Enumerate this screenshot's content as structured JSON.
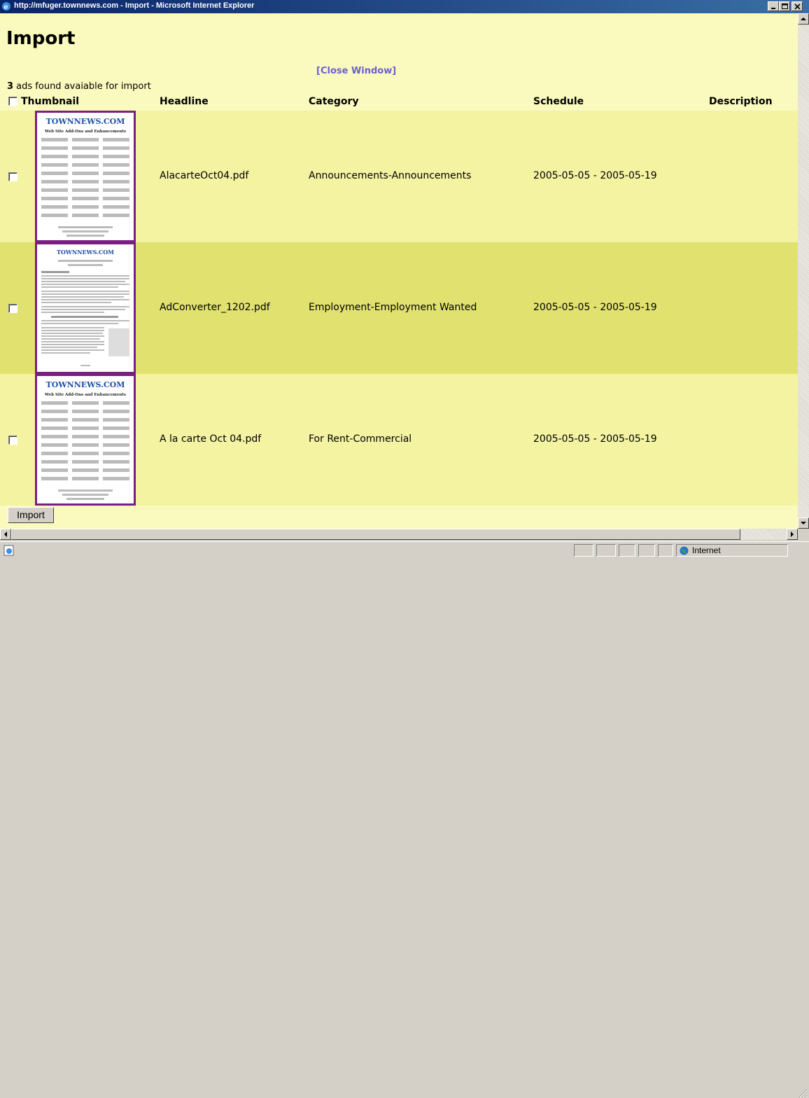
{
  "window": {
    "title": "http://mfuger.townnews.com - Import - Microsoft Internet Explorer"
  },
  "page": {
    "title": "Import",
    "close_link": "[Close Window]",
    "found_count": "3",
    "found_text": " ads found avaiable for import"
  },
  "table": {
    "headers": {
      "thumbnail": "Thumbnail",
      "headline": "Headline",
      "category": "Category",
      "schedule": "Schedule",
      "description": "Description"
    },
    "rows": [
      {
        "headline": "AlacarteOct04.pdf",
        "category": "Announcements-Announcements",
        "schedule": "2005-05-05 - 2005-05-19",
        "description": "",
        "thumb_title": "Web Site Add-Ons and Enhancements"
      },
      {
        "headline": "AdConverter_1202.pdf",
        "category": "Employment-Employment Wanted",
        "schedule": "2005-05-05 - 2005-05-19",
        "description": "",
        "thumb_title": ""
      },
      {
        "headline": "A la carte Oct 04.pdf",
        "category": "For Rent-Commercial",
        "schedule": "2005-05-05 - 2005-05-19",
        "description": "",
        "thumb_title": "Web Site Add-Ons and Enhancements"
      }
    ]
  },
  "actions": {
    "import_label": "Import"
  },
  "statusbar": {
    "zone": "Internet"
  },
  "colors": {
    "page_bg": "#fafabe",
    "row_light": "#f3f3a2",
    "row_dark": "#e1e170",
    "thumb_border": "#7a1f82",
    "link": "#6a5fd0"
  }
}
